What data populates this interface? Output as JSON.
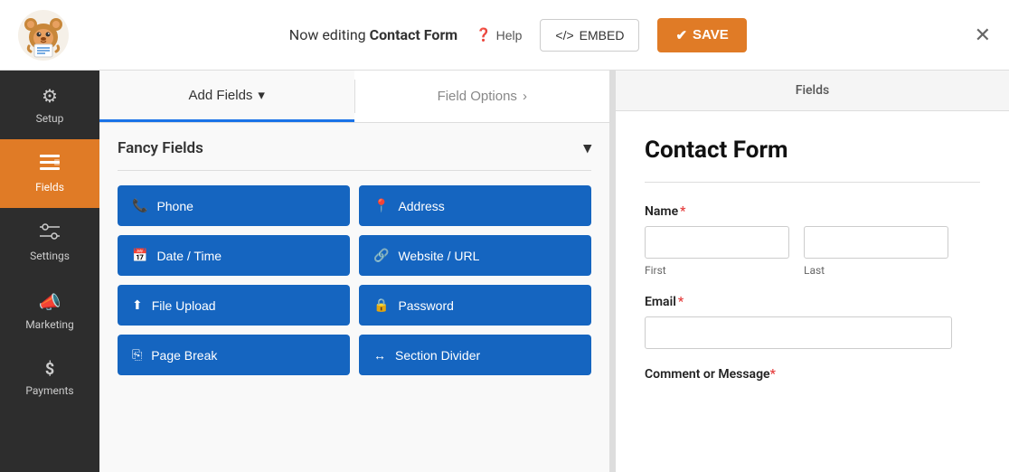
{
  "topbar": {
    "editing_prefix": "Now editing ",
    "form_name": "Contact Form",
    "help_label": "Help",
    "embed_label": "EMBED",
    "save_label": "SAVE"
  },
  "sidebar": {
    "items": [
      {
        "id": "setup",
        "label": "Setup",
        "icon": "⚙️",
        "active": false
      },
      {
        "id": "fields",
        "label": "Fields",
        "icon": "☰",
        "active": true
      },
      {
        "id": "settings",
        "label": "Settings",
        "icon": "⚡",
        "active": false
      },
      {
        "id": "marketing",
        "label": "Marketing",
        "icon": "📣",
        "active": false
      },
      {
        "id": "payments",
        "label": "Payments",
        "icon": "$",
        "active": false
      }
    ]
  },
  "fields_panel": {
    "tabs": [
      {
        "id": "add-fields",
        "label": "Add Fields",
        "active": true
      },
      {
        "id": "field-options",
        "label": "Field Options",
        "active": false
      }
    ],
    "fancy_fields_label": "Fancy Fields",
    "field_buttons": [
      {
        "id": "phone",
        "label": "Phone",
        "icon": "📞"
      },
      {
        "id": "address",
        "label": "Address",
        "icon": "📍"
      },
      {
        "id": "datetime",
        "label": "Date / Time",
        "icon": "📅"
      },
      {
        "id": "website",
        "label": "Website / URL",
        "icon": "🔗"
      },
      {
        "id": "file-upload",
        "label": "File Upload",
        "icon": "⬆"
      },
      {
        "id": "password",
        "label": "Password",
        "icon": "🔒"
      },
      {
        "id": "page-break",
        "label": "Page Break",
        "icon": "⎘"
      },
      {
        "id": "section-divider",
        "label": "Section Divider",
        "icon": "↔"
      }
    ]
  },
  "form_preview": {
    "header_label": "Fields",
    "form_title": "Contact Form",
    "name_label": "Name",
    "name_required": "*",
    "first_sublabel": "First",
    "last_sublabel": "Last",
    "email_label": "Email",
    "email_required": "*",
    "comment_label": "Comment or Message",
    "comment_required": "*"
  }
}
